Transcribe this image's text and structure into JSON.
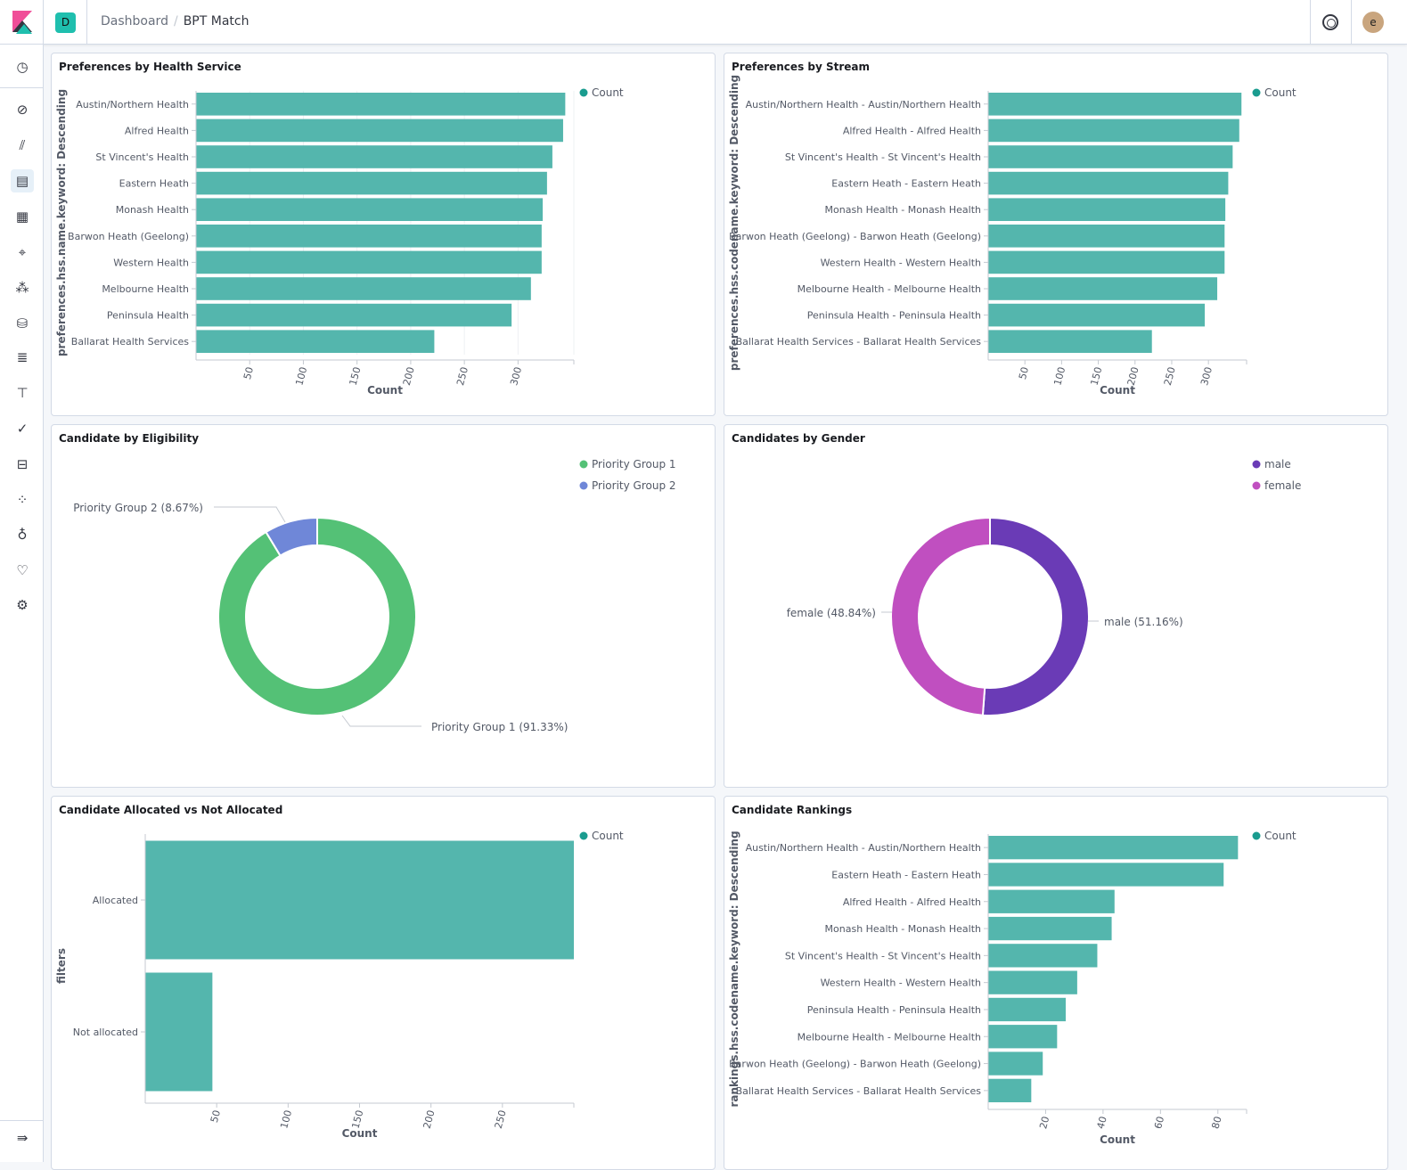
{
  "header": {
    "space_initial": "D",
    "breadcrumbs": [
      "Dashboard",
      "BPT Match"
    ],
    "avatar_initial": "e"
  },
  "sidebar": {
    "items": [
      {
        "name": "recently-viewed",
        "icon": "clock-icon",
        "glyph": "◷"
      },
      {
        "name": "discover",
        "icon": "compass-icon",
        "glyph": "⊘"
      },
      {
        "name": "visualize",
        "icon": "chart-icon",
        "glyph": "⫽"
      },
      {
        "name": "dashboard",
        "icon": "dashboard-icon",
        "glyph": "▤",
        "active": true
      },
      {
        "name": "canvas",
        "icon": "canvas-icon",
        "glyph": "▦"
      },
      {
        "name": "maps",
        "icon": "map-pin-icon",
        "glyph": "⌖"
      },
      {
        "name": "ml",
        "icon": "ml-icon",
        "glyph": "⁂"
      },
      {
        "name": "infrastructure",
        "icon": "infra-icon",
        "glyph": "⛁"
      },
      {
        "name": "logs",
        "icon": "logs-icon",
        "glyph": "≣"
      },
      {
        "name": "apm",
        "icon": "apm-icon",
        "glyph": "⊤"
      },
      {
        "name": "uptime",
        "icon": "uptime-icon",
        "glyph": "✓"
      },
      {
        "name": "siem",
        "icon": "lock-icon",
        "glyph": "⊟"
      },
      {
        "name": "graph",
        "icon": "graph-icon",
        "glyph": "⁘"
      },
      {
        "name": "dev-tools",
        "icon": "wrench-icon",
        "glyph": "♁"
      },
      {
        "name": "monitoring",
        "icon": "heartbeat-icon",
        "glyph": "♡"
      },
      {
        "name": "management",
        "icon": "gear-icon",
        "glyph": "⚙"
      }
    ],
    "collapse_glyph": "⇛"
  },
  "colors": {
    "bar": "#54b6ad",
    "pg1": "#54c176",
    "pg2": "#6f87d8",
    "male": "#6a3bb6",
    "female": "#c04fc0"
  },
  "chart_data": [
    {
      "type": "bar",
      "orientation": "horizontal",
      "title": "Preferences by Health Service",
      "ylabel": "preferences.hss.name.keyword: Descending",
      "xlabel": "Count",
      "legend": [
        "Count"
      ],
      "legend_position": "top-right",
      "xlim": [
        0,
        352
      ],
      "ticks": [
        50,
        100,
        150,
        200,
        250,
        300
      ],
      "grid": true,
      "categories": [
        "Austin/Northern Health",
        "Alfred Health",
        "St Vincent's Health",
        "Eastern Heath",
        "Monash Health",
        "Barwon Heath (Geelong)",
        "Western Health",
        "Melbourne Health",
        "Peninsula Health",
        "Ballarat Health Services"
      ],
      "values": [
        344,
        342,
        332,
        327,
        323,
        322,
        322,
        312,
        294,
        222
      ]
    },
    {
      "type": "bar",
      "orientation": "horizontal",
      "title": "Preferences by Stream",
      "ylabel": "preferences.hss.codename.keyword: Descending",
      "xlabel": "Count",
      "legend": [
        "Count"
      ],
      "legend_position": "top-right",
      "xlim": [
        0,
        352
      ],
      "ticks": [
        50,
        100,
        150,
        200,
        250,
        300
      ],
      "grid": false,
      "categories": [
        "Austin/Northern Health - Austin/Northern Health",
        "Alfred Health - Alfred Health",
        "St Vincent's Health - St Vincent's Health",
        "Eastern Heath - Eastern Heath",
        "Monash Health - Monash Health",
        "Barwon Heath (Geelong) - Barwon Heath (Geelong)",
        "Western Health - Western Health",
        "Melbourne Health - Melbourne Health",
        "Peninsula Health - Peninsula Health",
        "Ballarat Health Services - Ballarat Health Services"
      ],
      "values": [
        345,
        342,
        333,
        327,
        323,
        322,
        322,
        312,
        295,
        223
      ]
    },
    {
      "type": "pie",
      "donut": true,
      "title": "Candidate by Eligibility",
      "legend": [
        "Priority Group 1",
        "Priority Group 2"
      ],
      "legend_position": "top-right",
      "slices": [
        {
          "label": "Priority Group 1",
          "percent": 91.33,
          "text": "Priority Group 1 (91.33%)"
        },
        {
          "label": "Priority Group 2",
          "percent": 8.67,
          "text": "Priority Group 2 (8.67%)"
        }
      ]
    },
    {
      "type": "pie",
      "donut": true,
      "title": "Candidates by Gender",
      "legend": [
        "male",
        "female"
      ],
      "legend_position": "top-right",
      "slices": [
        {
          "label": "male",
          "percent": 51.16,
          "text": "male (51.16%)"
        },
        {
          "label": "female",
          "percent": 48.84,
          "text": "female (48.84%)"
        }
      ]
    },
    {
      "type": "bar",
      "orientation": "horizontal",
      "title": "Candidate Allocated vs Not Allocated",
      "ylabel": "filters",
      "xlabel": "Count",
      "legend": [
        "Count"
      ],
      "legend_position": "top-right",
      "xlim": [
        0,
        300
      ],
      "ticks": [
        50,
        100,
        150,
        200,
        250
      ],
      "grid": false,
      "categories": [
        "Allocated",
        "Not allocated"
      ],
      "values": [
        300,
        47
      ]
    },
    {
      "type": "bar",
      "orientation": "horizontal",
      "title": "Candidate Rankings",
      "ylabel": "rankings.hss.codename.keyword: Descending",
      "xlabel": "Count",
      "legend": [
        "Count"
      ],
      "legend_position": "top-right",
      "xlim": [
        0,
        90
      ],
      "ticks": [
        20,
        40,
        60,
        80
      ],
      "grid": false,
      "categories": [
        "Austin/Northern Health - Austin/Northern Health",
        "Eastern Heath - Eastern Heath",
        "Alfred Health - Alfred Health",
        "Monash Health - Monash Health",
        "St Vincent's Health - St Vincent's Health",
        "Western Health - Western Health",
        "Peninsula Health - Peninsula Health",
        "Melbourne Health - Melbourne Health",
        "Barwon Heath (Geelong) - Barwon Heath (Geelong)",
        "Ballarat Health Services - Ballarat Health Services"
      ],
      "values": [
        87,
        82,
        44,
        43,
        38,
        31,
        27,
        24,
        19,
        15
      ]
    }
  ]
}
